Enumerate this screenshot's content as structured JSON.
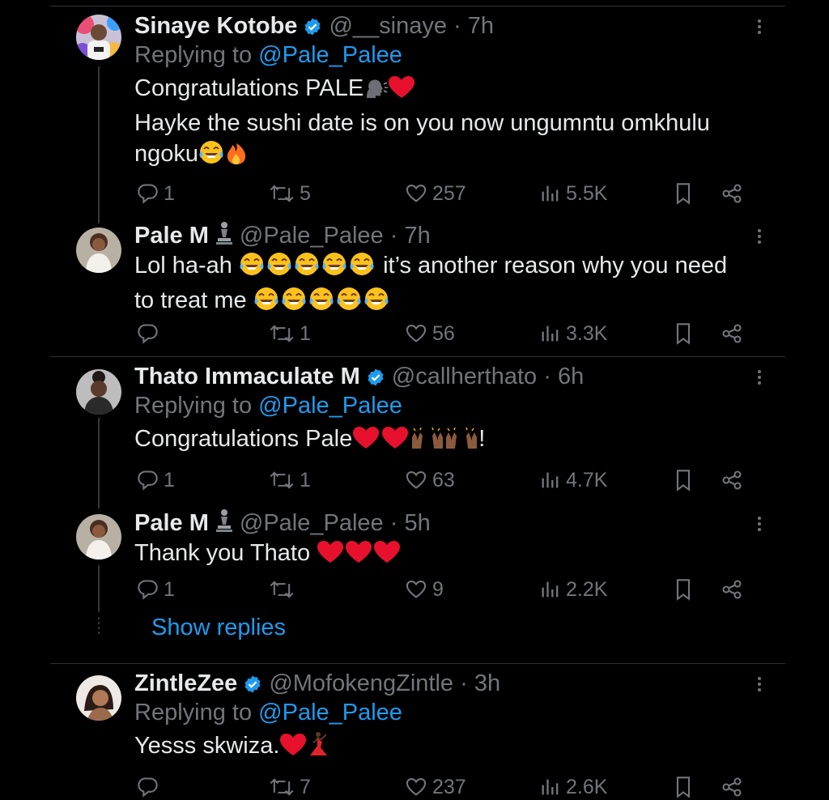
{
  "tweets": [
    {
      "name": "Sinaye Kotobe",
      "verified": true,
      "handle": "@__sinaye",
      "time": "7h",
      "replying_prefix": "Replying to",
      "replying_to": "@Pale_Palee",
      "text_line1": "Congratulations PALE",
      "text_line2": "Hayke the sushi date is on you now ungumntu omkhulu",
      "text_line3": "ngoku",
      "replies": "1",
      "retweets": "5",
      "likes": "257",
      "views": "5.5K"
    },
    {
      "name": "Pale M",
      "handle": "@Pale_Palee",
      "time": "7h",
      "text_line1_a": "Lol ha-ah",
      "text_line1_b": "it’s another reason why you need",
      "text_line2": "to treat me",
      "replies": "",
      "retweets": "1",
      "likes": "56",
      "views": "3.3K"
    },
    {
      "name": "Thato Immaculate M",
      "verified": true,
      "handle": "@callherthato",
      "time": "6h",
      "replying_prefix": "Replying to",
      "replying_to": "@Pale_Palee",
      "text": "Congratulations Pale",
      "text_suffix": "!",
      "replies": "1",
      "retweets": "1",
      "likes": "63",
      "views": "4.7K"
    },
    {
      "name": "Pale M",
      "handle": "@Pale_Palee",
      "time": "5h",
      "text": "Thank you Thato",
      "replies": "1",
      "retweets": "",
      "likes": "9",
      "views": "2.2K"
    },
    {
      "name": "ZintleZee",
      "verified": true,
      "handle": "@MofokengZintle",
      "time": "3h",
      "replying_prefix": "Replying to",
      "replying_to": "@Pale_Palee",
      "text": "Yesss skwiza.",
      "replies": "",
      "retweets": "7",
      "likes": "237",
      "views": "2.6K"
    }
  ],
  "show_replies": "Show replies",
  "colors": {
    "background": "#000000",
    "text": "#e7e9ea",
    "muted": "#71767b",
    "accent": "#1d9bf0",
    "heart": "#f91880"
  }
}
